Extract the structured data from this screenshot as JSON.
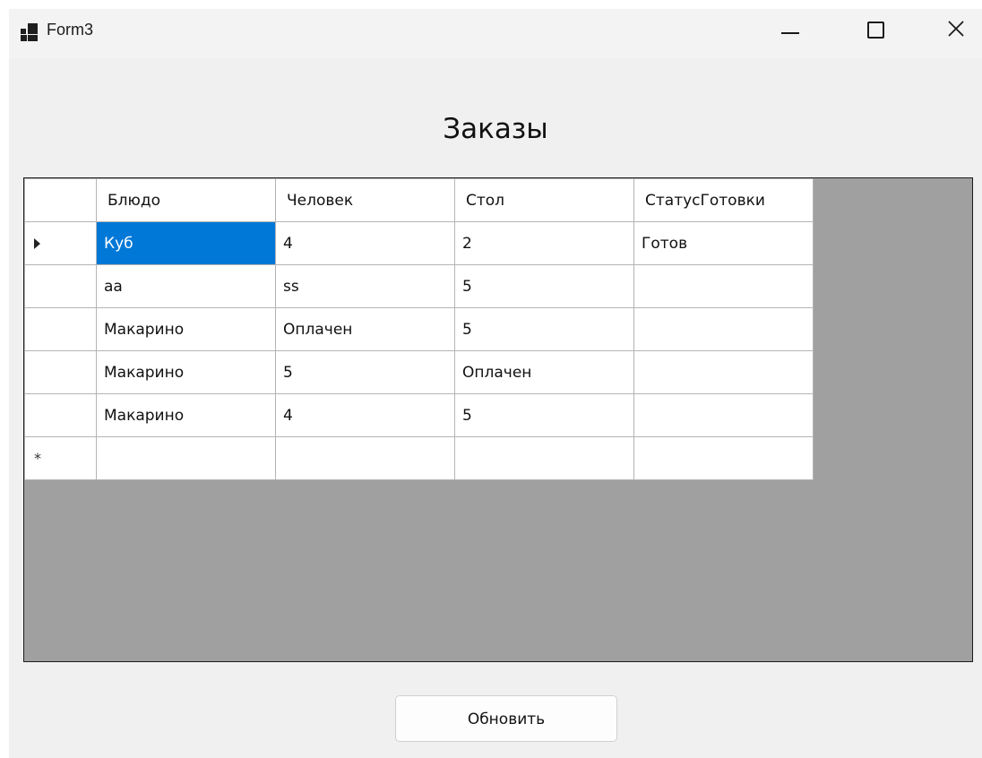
{
  "window": {
    "title": "Form3"
  },
  "heading": "Заказы",
  "grid": {
    "columns": [
      "Блюдо",
      "Человек",
      "Стол",
      "СтатусГотовки"
    ],
    "rows": [
      [
        "Куб",
        "4",
        "2",
        "Готов"
      ],
      [
        "аа",
        "ss",
        "5",
        ""
      ],
      [
        "Макарино",
        "Оплачен",
        "5",
        ""
      ],
      [
        "Макарино",
        "5",
        "Оплачен",
        ""
      ],
      [
        "Макарино",
        "4",
        "5",
        ""
      ]
    ],
    "new_row_marker": "*",
    "selected": {
      "row": 0,
      "column": 0
    }
  },
  "buttons": {
    "refresh": "Обновить"
  },
  "colors": {
    "selection": "#0078d7",
    "grid_background": "#a0a0a0",
    "form_background": "#f0f0f0"
  }
}
